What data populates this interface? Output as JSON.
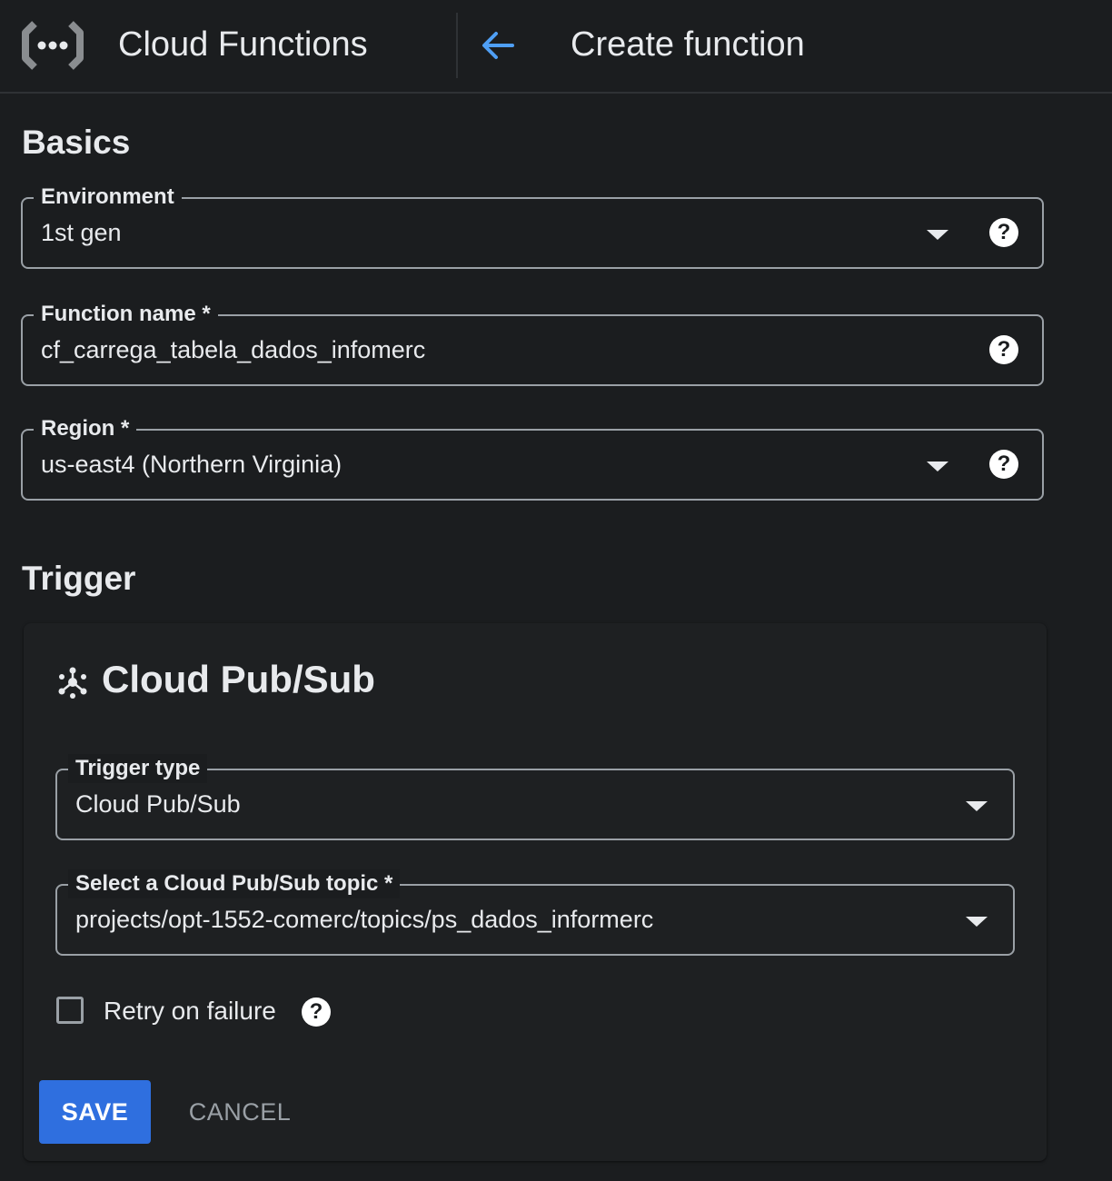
{
  "header": {
    "app_title": "Cloud Functions",
    "page_title": "Create function"
  },
  "basics": {
    "heading": "Basics",
    "environment": {
      "label": "Environment",
      "value": "1st gen"
    },
    "function_name": {
      "label": "Function name *",
      "value": "cf_carrega_tabela_dados_infomerc"
    },
    "region": {
      "label": "Region *",
      "value": "us-east4 (Northern Virginia)"
    }
  },
  "trigger": {
    "heading": "Trigger",
    "card_title": "Cloud Pub/Sub",
    "trigger_type": {
      "label": "Trigger type",
      "value": "Cloud Pub/Sub"
    },
    "topic": {
      "label": "Select a Cloud Pub/Sub topic *",
      "value": "projects/opt-1552-comerc/topics/ps_dados_informerc"
    },
    "retry": {
      "label": "Retry on failure",
      "checked": false
    },
    "save_label": "SAVE",
    "cancel_label": "CANCEL"
  },
  "icons": {
    "logo": "cloud-functions-logo-icon",
    "back": "arrow-back-icon",
    "help": "help-icon",
    "dropdown": "caret-down-icon",
    "pubsub": "pubsub-icon",
    "help_glyph": "?"
  },
  "colors": {
    "background": "#1b1d1f",
    "accent": "#2f6fdf",
    "back_arrow": "#4f9ff5",
    "border": "#9aa0a6"
  }
}
